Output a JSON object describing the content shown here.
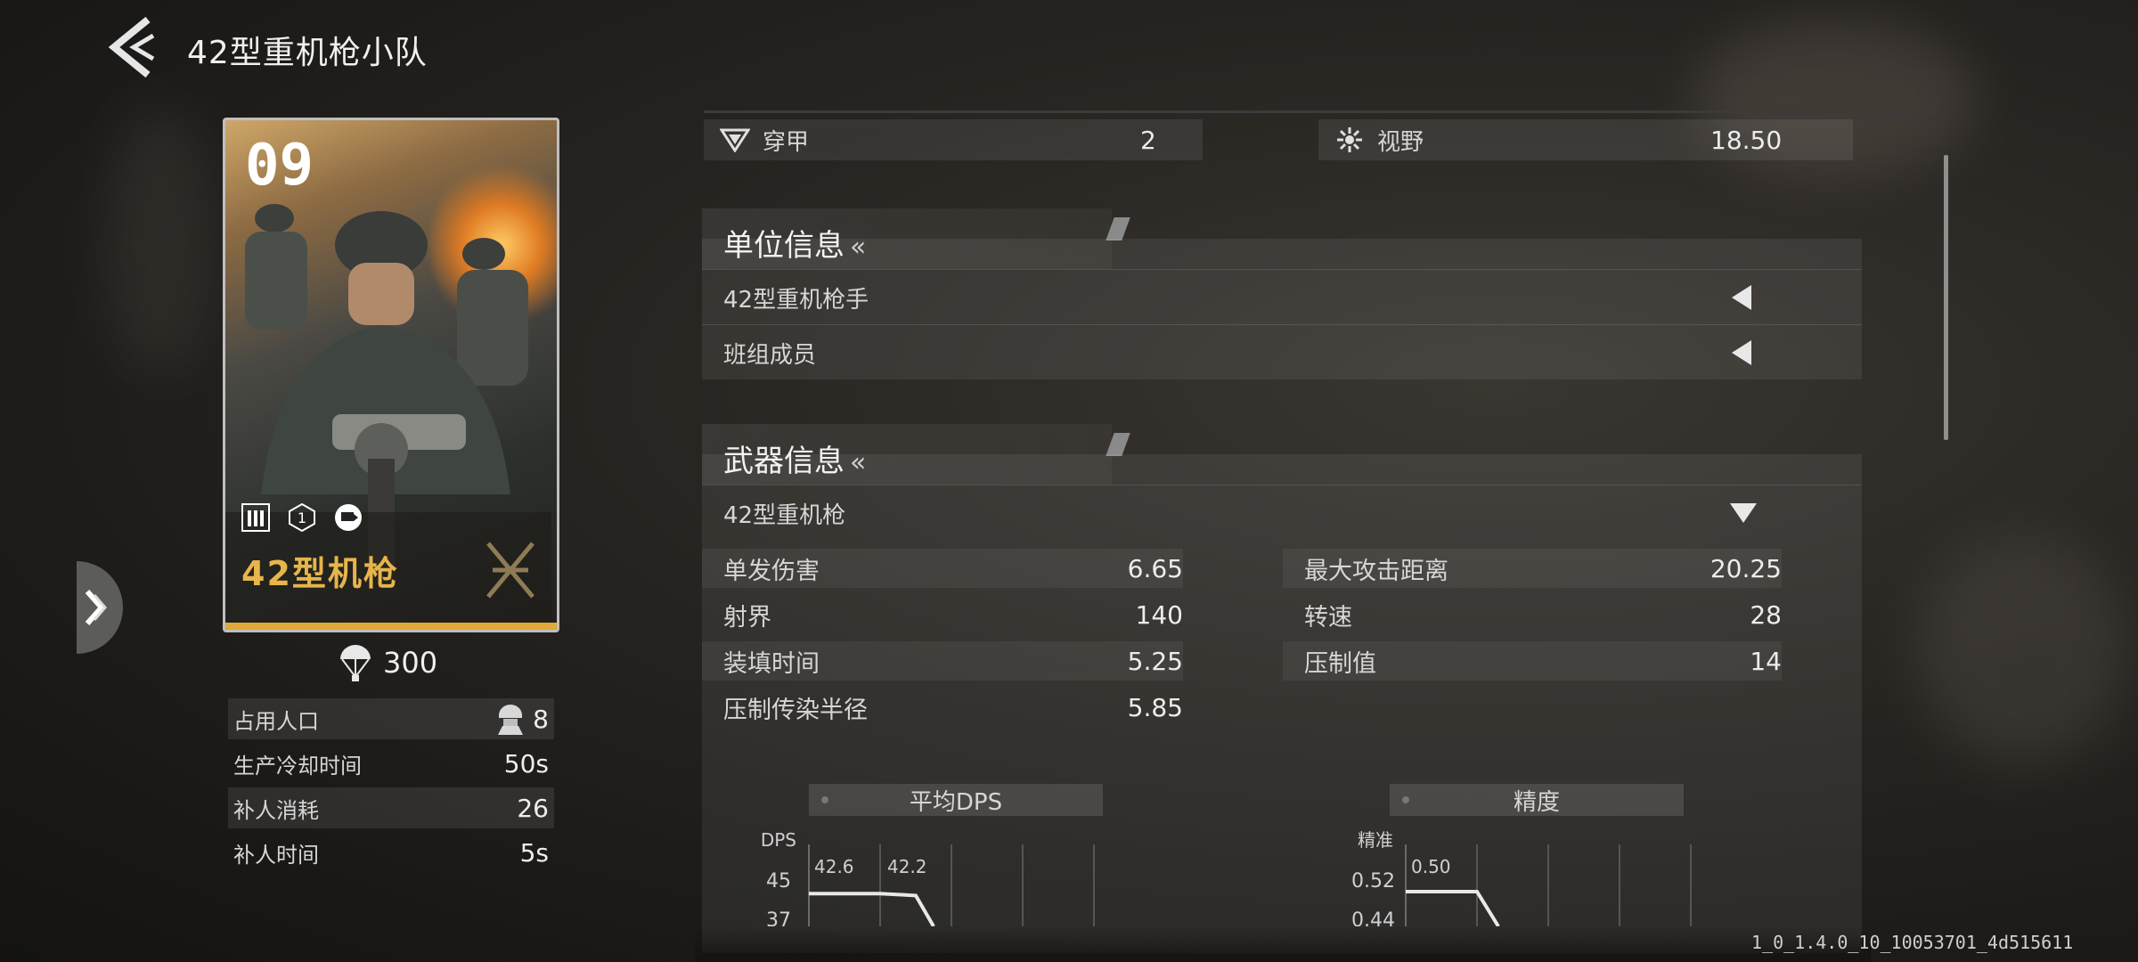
{
  "header": {
    "title": "42型重机枪小队"
  },
  "card": {
    "number": "09",
    "name": "42型机枪",
    "level_badge": "1"
  },
  "cost": {
    "value": "300",
    "icon": "parachute-icon"
  },
  "stats": [
    {
      "label": "占用人口",
      "value": "8",
      "icon": "soldier-head-icon"
    },
    {
      "label": "生产冷却时间",
      "value": "50s"
    },
    {
      "label": "补人消耗",
      "value": "26"
    },
    {
      "label": "补人时间",
      "value": "5s"
    }
  ],
  "attributes": [
    {
      "label": "穿甲",
      "value": "2",
      "icon": "armor-pierce-icon"
    },
    {
      "label": "视野",
      "value": "18.50",
      "icon": "vision-icon"
    }
  ],
  "unit_info": {
    "title": "单位信息",
    "arrows": "«",
    "rows": [
      {
        "label": "42型重机枪手"
      },
      {
        "label": "班组成员"
      }
    ]
  },
  "weapon_info": {
    "title": "武器信息",
    "arrows": "«",
    "weapon_name": "42型重机枪",
    "left_stats": [
      {
        "label": "单发伤害",
        "value": "6.65"
      },
      {
        "label": "射界",
        "value": "140"
      },
      {
        "label": "装填时间",
        "value": "5.25"
      },
      {
        "label": "压制传染半径",
        "value": "5.85"
      }
    ],
    "right_stats": [
      {
        "label": "最大攻击距离",
        "value": "20.25"
      },
      {
        "label": "转速",
        "value": "28"
      },
      {
        "label": "压制值",
        "value": "14"
      }
    ]
  },
  "chart_data": [
    {
      "type": "line",
      "title": "平均DPS",
      "ylabel": "DPS",
      "y_ticks": [
        "45",
        "37"
      ],
      "series": [
        {
          "values": [
            42.6,
            42.6,
            42.2
          ]
        }
      ],
      "data_labels": [
        "42.6",
        "42.2"
      ]
    },
    {
      "type": "line",
      "title": "精度",
      "ylabel": "精准",
      "y_ticks": [
        "0.52",
        "0.44"
      ],
      "series": [
        {
          "values": [
            0.5,
            0.5
          ]
        }
      ],
      "data_labels": [
        "0.50"
      ]
    }
  ],
  "footer": {
    "version": "1_0_1.4.0_10_10053701_4d515611"
  },
  "colors": {
    "accent": "#e7b54a",
    "panel": "#2e2b28"
  }
}
